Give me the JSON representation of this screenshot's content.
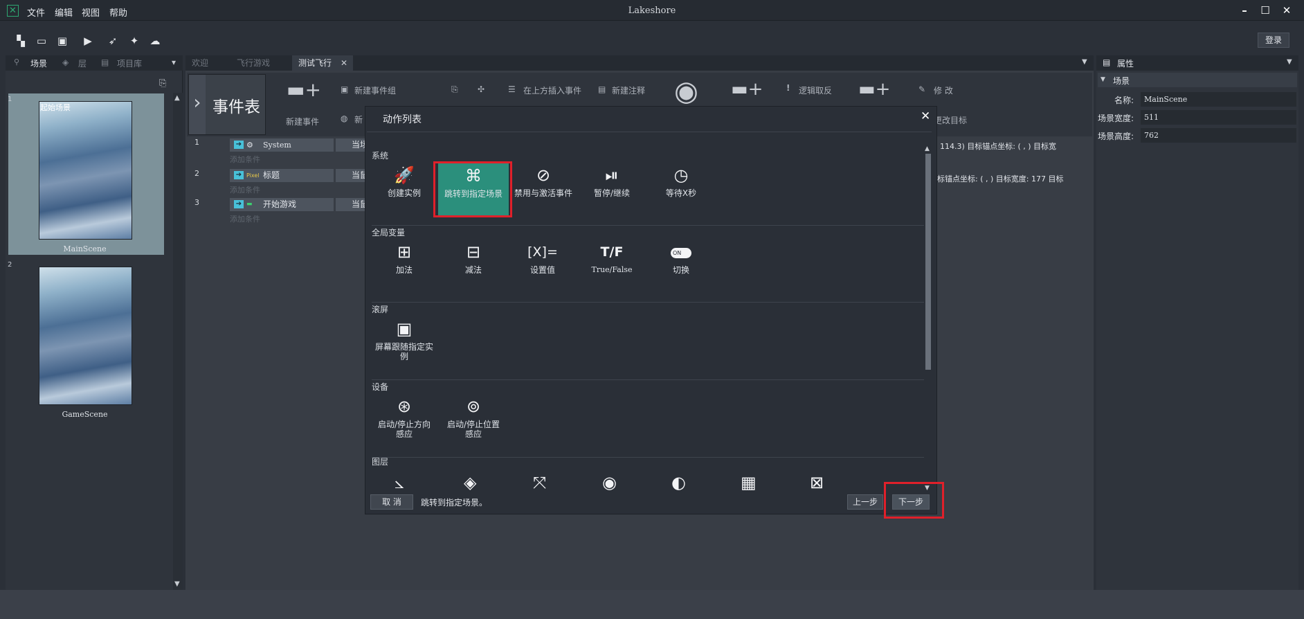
{
  "window": {
    "title": "Lakeshore",
    "menu": [
      "文件",
      "编辑",
      "视图",
      "帮助"
    ],
    "login": "登录"
  },
  "toolbar_icons": [
    "new-scene-icon",
    "open-folder-icon",
    "save-icon",
    "play-icon",
    "rocket-icon",
    "share-icon",
    "cloud-upload-icon"
  ],
  "left_panel": {
    "tabs": [
      "场景",
      "层",
      "项目库"
    ],
    "scenes": [
      {
        "num": "1",
        "title_overlay": "起始场景",
        "label": "MainScene"
      },
      {
        "num": "2",
        "title_overlay": "",
        "label": "GameScene"
      }
    ]
  },
  "doc_tabs": [
    "欢迎",
    "飞行游戏",
    "测试飞行"
  ],
  "ribbon": {
    "title": "事件表",
    "new_event": "新建事件",
    "new_event_group": "新建事件组",
    "new_partial": "新",
    "insert_above": "在上方插入事件",
    "new_comment": "新建注释",
    "logic_invert": "逻辑取反",
    "modify": "修  改",
    "change_target": "更改目标"
  },
  "events": [
    {
      "num": "1",
      "name": "System",
      "action": "当场",
      "add_cond": "添加条件"
    },
    {
      "num": "2",
      "name": "标题",
      "action": "当鼠",
      "add_cond": "添加条件"
    },
    {
      "num": "3",
      "name": "开始游戏",
      "action": "当鼠",
      "add_cond": "添加条件"
    }
  ],
  "events_right": [
    "114.3) 目标锚点坐标: ( , ) 目标宽",
    "标锚点坐标: ( , ) 目标宽度: 177 目标"
  ],
  "right_panel": {
    "tab": "属性",
    "section": "场景",
    "props": [
      {
        "key": "名称:",
        "value": "MainScene"
      },
      {
        "key": "场景宽度:",
        "value": "511"
      },
      {
        "key": "场景高度:",
        "value": "762"
      }
    ]
  },
  "dialog": {
    "title": "动作列表",
    "categories": {
      "system": "系统",
      "global_vars": "全局变量",
      "scroll": "滚屏",
      "device": "设备",
      "layer": "图层"
    },
    "system_actions": [
      "创建实例",
      "跳转到指定场景",
      "禁用与激活事件",
      "暂停/继续",
      "等待X秒"
    ],
    "global_actions": [
      "加法",
      "减法",
      "设置值",
      "True/False",
      "切换"
    ],
    "scroll_actions": [
      "屏幕跟随指定实",
      "例"
    ],
    "device_actions": [
      [
        "启动/停止方向",
        "感应"
      ],
      [
        "启动/停止位置",
        "感应"
      ]
    ],
    "toggle_on": "ON",
    "cancel": "取 消",
    "description": "跳转到指定场景。",
    "prev": "上一步",
    "next": "下一步"
  }
}
